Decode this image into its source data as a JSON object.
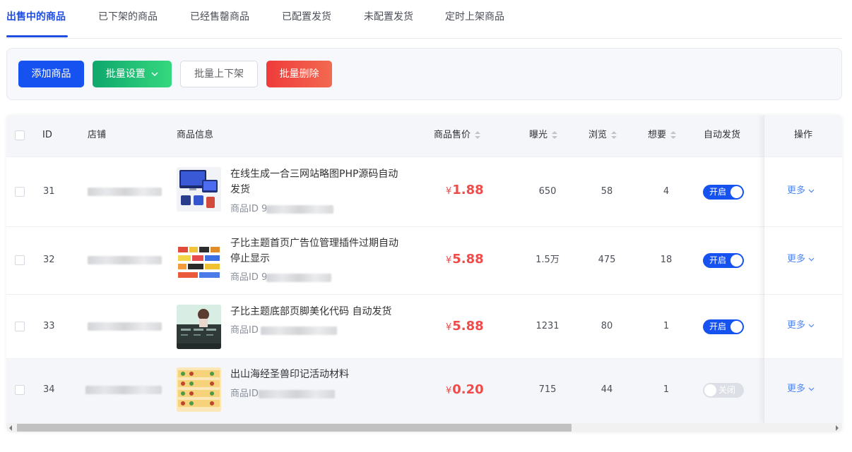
{
  "tabs": [
    {
      "label": "出售中的商品",
      "active": true
    },
    {
      "label": "已下架的商品",
      "active": false
    },
    {
      "label": "已经售罄商品",
      "active": false
    },
    {
      "label": "已配置发货",
      "active": false
    },
    {
      "label": "未配置发货",
      "active": false
    },
    {
      "label": "定时上架商品",
      "active": false
    }
  ],
  "toolbar": {
    "add_label": "添加商品",
    "batch_settings_label": "批量设置",
    "batch_shelf_label": "批量上下架",
    "batch_delete_label": "批量删除"
  },
  "table": {
    "columns": {
      "id": "ID",
      "shop": "店铺",
      "info": "商品信息",
      "price": "商品售价",
      "exposure": "曝光",
      "views": "浏览",
      "wants": "想要",
      "auto_ship": "自动发货",
      "actions": "操作"
    },
    "rows": [
      {
        "id": "31",
        "title": "在线生成一合三网站略图PHP源码自动发货",
        "pid_label": "商品ID 9",
        "yen": "¥",
        "price": "1.88",
        "exposure": "650",
        "views": "58",
        "wants": "4",
        "auto_ship_on": true,
        "toggle_label": "开启",
        "more_label": "更多"
      },
      {
        "id": "32",
        "title": "子比主题首页广告位管理插件过期自动停止显示",
        "pid_label": "商品ID 9",
        "yen": "¥",
        "price": "5.88",
        "exposure": "1.5万",
        "views": "475",
        "wants": "18",
        "auto_ship_on": true,
        "toggle_label": "开启",
        "more_label": "更多"
      },
      {
        "id": "33",
        "title": "子比主题底部页脚美化代码 自动发货",
        "pid_label": "商品ID",
        "yen": "¥",
        "price": "5.88",
        "exposure": "1231",
        "views": "80",
        "wants": "1",
        "auto_ship_on": true,
        "toggle_label": "开启",
        "more_label": "更多"
      },
      {
        "id": "34",
        "title": "出山海经圣兽印记活动材料",
        "pid_label": "商品ID",
        "yen": "¥",
        "price": "0.20",
        "exposure": "715",
        "views": "44",
        "wants": "1",
        "auto_ship_on": false,
        "toggle_label": "关闭",
        "more_label": "更多"
      }
    ]
  },
  "colors": {
    "primary": "#1552f0",
    "success_gradient": "#0fa76d",
    "danger": "#ef3b3b",
    "price": "#ef4b4b",
    "link": "#4f86f4"
  }
}
